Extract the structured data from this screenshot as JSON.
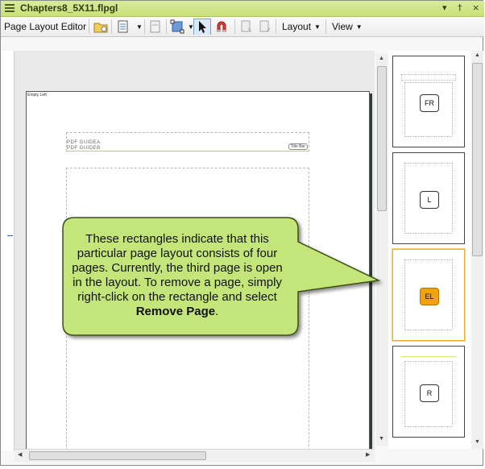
{
  "window": {
    "title": "Chapters8_5X11.flpgl",
    "controls": [
      "▾",
      "†",
      "×"
    ]
  },
  "toolbar": {
    "label": "Page Layout Editor",
    "layout_menu": "Layout",
    "view_menu": "View"
  },
  "page": {
    "tag": "Empty Left",
    "header_line1": "PDF GUIDEA",
    "header_line2": "PDF GUIDEB",
    "header_chip": "Title Bar"
  },
  "thumbnails": [
    {
      "label": "FR",
      "selected": false
    },
    {
      "label": "L",
      "selected": false
    },
    {
      "label": "EL",
      "selected": true
    },
    {
      "label": "R",
      "selected": false
    }
  ],
  "callout": {
    "text_before": "These rectangles indicate that this particular page layout consists of four pages. Currently, the third page is open in the layout. To remove a page, simply right-click on the rectangle and select ",
    "bold_text": "Remove Page",
    "text_after": "."
  },
  "colors": {
    "titlebar": "#c9e07a",
    "callout_fill": "#c3e57a",
    "selected_accent": "#f2a20a"
  }
}
